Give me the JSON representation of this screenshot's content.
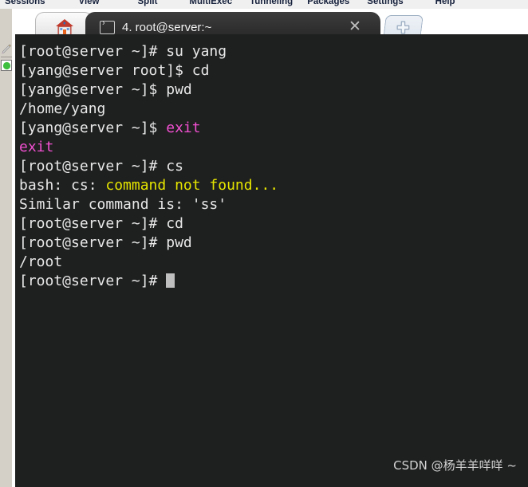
{
  "menubar": {
    "items": [
      {
        "label": "Sessions"
      },
      {
        "label": "View"
      },
      {
        "label": "Split"
      },
      {
        "label": "MultiExec"
      },
      {
        "label": "Tunneling"
      },
      {
        "label": "Packages"
      },
      {
        "label": "Settings"
      },
      {
        "label": "Help"
      }
    ]
  },
  "sidebar": {
    "tools": [
      {
        "name": "pencil-icon"
      },
      {
        "name": "green-circle-icon"
      }
    ]
  },
  "tabs": {
    "home_tab": {
      "icon": "home-icon",
      "label": ""
    },
    "active_tab": {
      "icon": "terminal-icon",
      "label": "4. root@server:~",
      "close_label": "✕"
    },
    "new_tab_label": "+"
  },
  "terminal": {
    "background": "#1e1f1f",
    "foreground": "#e8e8e8",
    "magenta": "#f050d0",
    "yellow": "#e6e600",
    "lines": [
      {
        "id": "l1",
        "segments": [
          {
            "text": "[root@server ~]# su yang",
            "color": "default"
          }
        ]
      },
      {
        "id": "l2",
        "segments": [
          {
            "text": "[yang@server root]$ cd",
            "color": "default"
          }
        ]
      },
      {
        "id": "l3",
        "segments": [
          {
            "text": "[yang@server ~]$ pwd",
            "color": "default"
          }
        ]
      },
      {
        "id": "l4",
        "segments": [
          {
            "text": "/home/yang",
            "color": "default"
          }
        ]
      },
      {
        "id": "l5",
        "segments": [
          {
            "text": "[yang@server ~]$ ",
            "color": "default"
          },
          {
            "text": "exit",
            "color": "magenta"
          }
        ]
      },
      {
        "id": "l6",
        "segments": [
          {
            "text": "exit",
            "color": "magenta"
          }
        ]
      },
      {
        "id": "l7",
        "segments": [
          {
            "text": "[root@server ~]# cs",
            "color": "default"
          }
        ]
      },
      {
        "id": "l8",
        "segments": [
          {
            "text": "bash: cs: ",
            "color": "default"
          },
          {
            "text": "command not found...",
            "color": "yellow"
          }
        ]
      },
      {
        "id": "l9",
        "segments": [
          {
            "text": "Similar command is: 'ss'",
            "color": "default"
          }
        ]
      },
      {
        "id": "l10",
        "segments": [
          {
            "text": "[root@server ~]# cd",
            "color": "default"
          }
        ]
      },
      {
        "id": "l11",
        "segments": [
          {
            "text": "[root@server ~]# pwd",
            "color": "default"
          }
        ]
      },
      {
        "id": "l12",
        "segments": [
          {
            "text": "/root",
            "color": "default"
          }
        ]
      },
      {
        "id": "l13",
        "segments": [
          {
            "text": "[root@server ~]# ",
            "color": "default"
          }
        ],
        "cursor": true
      }
    ]
  },
  "watermark": {
    "text": "CSDN @杨羊羊咩咩 ~"
  }
}
